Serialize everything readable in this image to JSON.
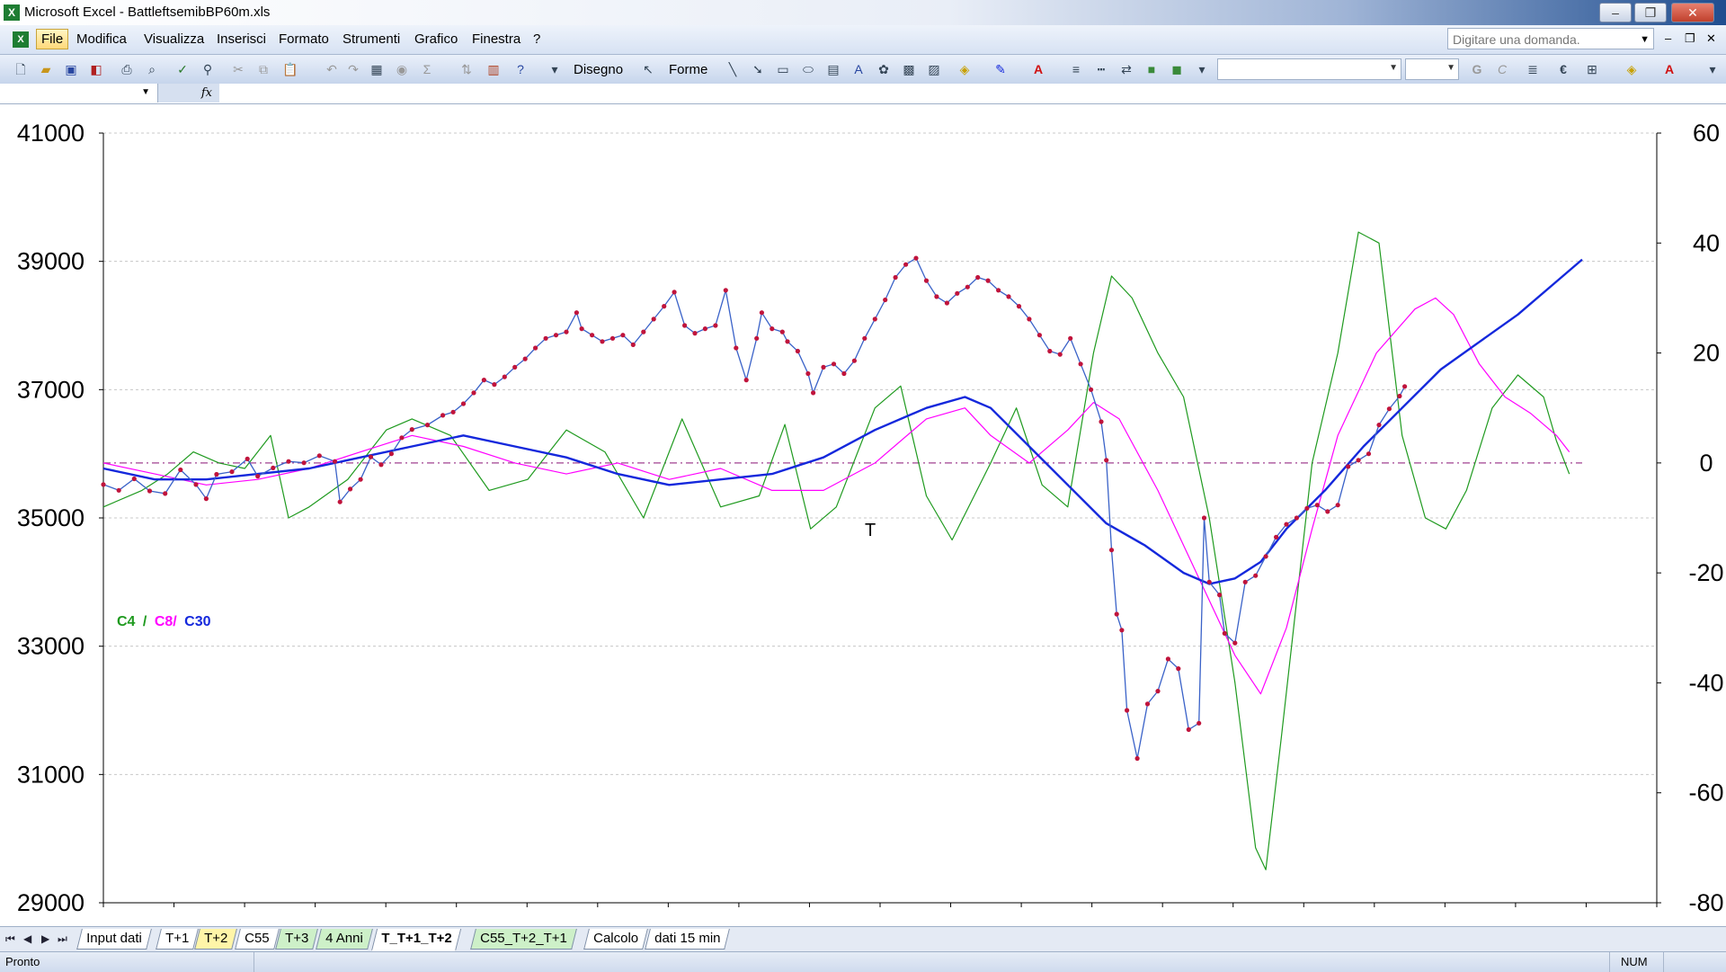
{
  "window": {
    "title": "Microsoft Excel - BattleftsemibBP60m.xls",
    "minimize": "–",
    "maximize": "❐",
    "close": "✕"
  },
  "menu": {
    "items": [
      "File",
      "Modifica",
      "Visualizza",
      "Inserisci",
      "Formato",
      "Strumenti",
      "Grafico",
      "Finestra",
      "?"
    ],
    "help_placeholder": "Digitare una domanda.",
    "doc_controls": [
      "–",
      "❐",
      "✕"
    ]
  },
  "toolbar": {
    "draw_label": "Disegno",
    "shapes_label": "Forme",
    "bold": "G",
    "italic": "C",
    "euro": "€"
  },
  "formula": {
    "fx": "fx"
  },
  "chart_data": {
    "type": "line",
    "legend": [
      {
        "label": "C4",
        "color": "#1f9a1f"
      },
      {
        "label": "/",
        "color": "#1f9a1f"
      },
      {
        "label": "C8/",
        "color": "#ff00ff"
      },
      {
        "label": "C30",
        "color": "#1428dc"
      }
    ],
    "y_left": {
      "min": 29000,
      "max": 41000,
      "ticks": [
        "41000",
        "39000",
        "37000",
        "35000",
        "33000",
        "31000",
        "29000"
      ]
    },
    "y_right": {
      "min": -80,
      "max": 60,
      "ticks": [
        "60",
        "40",
        "20",
        "0",
        "-20",
        "-40",
        "-60",
        "-80"
      ]
    },
    "annotation": "T",
    "colors": {
      "price": "#3a62c8",
      "marker": "#c0143c",
      "c4": "#1f9a1f",
      "c8": "#ff00ff",
      "c30": "#1428dc",
      "zero_line": "#a04090"
    },
    "price": {
      "x_range": [
        0,
        350
      ],
      "points": [
        [
          0,
          35520
        ],
        [
          6,
          35430
        ],
        [
          12,
          35610
        ],
        [
          18,
          35420
        ],
        [
          24,
          35380
        ],
        [
          30,
          35750
        ],
        [
          36,
          35520
        ],
        [
          40,
          35300
        ],
        [
          44,
          35680
        ],
        [
          50,
          35720
        ],
        [
          56,
          35920
        ],
        [
          60,
          35650
        ],
        [
          66,
          35780
        ],
        [
          72,
          35880
        ],
        [
          78,
          35860
        ],
        [
          84,
          35970
        ],
        [
          90,
          35880
        ],
        [
          92,
          35250
        ],
        [
          96,
          35450
        ],
        [
          100,
          35600
        ],
        [
          104,
          35950
        ],
        [
          108,
          35830
        ],
        [
          112,
          36000
        ],
        [
          116,
          36250
        ],
        [
          120,
          36380
        ],
        [
          126,
          36450
        ],
        [
          132,
          36600
        ],
        [
          136,
          36650
        ],
        [
          140,
          36780
        ],
        [
          144,
          36950
        ],
        [
          148,
          37150
        ],
        [
          152,
          37080
        ],
        [
          156,
          37200
        ],
        [
          160,
          37350
        ],
        [
          164,
          37480
        ],
        [
          168,
          37650
        ],
        [
          172,
          37800
        ],
        [
          176,
          37850
        ],
        [
          180,
          37900
        ],
        [
          184,
          38200
        ],
        [
          186,
          37950
        ],
        [
          190,
          37850
        ],
        [
          194,
          37750
        ],
        [
          198,
          37800
        ],
        [
          202,
          37850
        ],
        [
          206,
          37700
        ],
        [
          210,
          37900
        ],
        [
          214,
          38100
        ],
        [
          218,
          38300
        ],
        [
          222,
          38520
        ],
        [
          226,
          38000
        ],
        [
          230,
          37880
        ],
        [
          234,
          37950
        ],
        [
          238,
          38000
        ],
        [
          242,
          38550
        ],
        [
          246,
          37650
        ],
        [
          250,
          37150
        ],
        [
          254,
          37800
        ],
        [
          256,
          38200
        ],
        [
          260,
          37950
        ],
        [
          264,
          37900
        ],
        [
          266,
          37750
        ],
        [
          270,
          37600
        ],
        [
          274,
          37250
        ],
        [
          276,
          36950
        ],
        [
          280,
          37350
        ],
        [
          284,
          37400
        ],
        [
          288,
          37250
        ],
        [
          292,
          37450
        ],
        [
          296,
          37800
        ],
        [
          300,
          38100
        ],
        [
          304,
          38400
        ],
        [
          308,
          38750
        ],
        [
          312,
          38950
        ],
        [
          316,
          39050
        ],
        [
          320,
          38700
        ],
        [
          324,
          38450
        ],
        [
          328,
          38350
        ],
        [
          332,
          38500
        ],
        [
          336,
          38600
        ],
        [
          340,
          38750
        ],
        [
          344,
          38700
        ],
        [
          348,
          38550
        ],
        [
          352,
          38450
        ],
        [
          356,
          38300
        ],
        [
          360,
          38100
        ],
        [
          364,
          37850
        ],
        [
          368,
          37600
        ],
        [
          372,
          37550
        ],
        [
          376,
          37800
        ],
        [
          380,
          37400
        ],
        [
          384,
          37000
        ],
        [
          388,
          36500
        ],
        [
          390,
          35900
        ],
        [
          392,
          34500
        ],
        [
          394,
          33500
        ],
        [
          396,
          33250
        ],
        [
          398,
          32000
        ],
        [
          402,
          31250
        ],
        [
          406,
          32100
        ],
        [
          410,
          32300
        ],
        [
          414,
          32800
        ],
        [
          418,
          32650
        ],
        [
          422,
          31700
        ],
        [
          426,
          31800
        ],
        [
          428,
          35000
        ],
        [
          430,
          34000
        ],
        [
          434,
          33800
        ],
        [
          436,
          33200
        ],
        [
          440,
          33050
        ],
        [
          444,
          34000
        ],
        [
          448,
          34100
        ],
        [
          452,
          34400
        ],
        [
          456,
          34700
        ],
        [
          460,
          34900
        ],
        [
          464,
          35000
        ],
        [
          468,
          35150
        ],
        [
          472,
          35200
        ],
        [
          476,
          35100
        ],
        [
          480,
          35200
        ],
        [
          484,
          35800
        ],
        [
          488,
          35900
        ],
        [
          492,
          36000
        ],
        [
          496,
          36450
        ],
        [
          500,
          36700
        ],
        [
          504,
          36900
        ],
        [
          506,
          37050
        ]
      ]
    },
    "c4": [
      [
        0,
        -8
      ],
      [
        15,
        -5
      ],
      [
        25,
        -2
      ],
      [
        35,
        2
      ],
      [
        45,
        0
      ],
      [
        55,
        -1
      ],
      [
        65,
        5
      ],
      [
        72,
        -10
      ],
      [
        80,
        -8
      ],
      [
        95,
        -3
      ],
      [
        110,
        6
      ],
      [
        120,
        8
      ],
      [
        135,
        5
      ],
      [
        150,
        -5
      ],
      [
        165,
        -3
      ],
      [
        180,
        6
      ],
      [
        195,
        2
      ],
      [
        210,
        -10
      ],
      [
        225,
        8
      ],
      [
        240,
        -8
      ],
      [
        255,
        -6
      ],
      [
        265,
        7
      ],
      [
        275,
        -12
      ],
      [
        285,
        -8
      ],
      [
        300,
        10
      ],
      [
        310,
        14
      ],
      [
        320,
        -6
      ],
      [
        330,
        -14
      ],
      [
        345,
        0
      ],
      [
        355,
        10
      ],
      [
        365,
        -4
      ],
      [
        375,
        -8
      ],
      [
        385,
        20
      ],
      [
        392,
        34
      ],
      [
        400,
        30
      ],
      [
        410,
        20
      ],
      [
        420,
        12
      ],
      [
        430,
        -10
      ],
      [
        440,
        -40
      ],
      [
        448,
        -70
      ],
      [
        452,
        -74
      ],
      [
        458,
        -50
      ],
      [
        470,
        0
      ],
      [
        480,
        20
      ],
      [
        488,
        42
      ],
      [
        496,
        40
      ],
      [
        505,
        5
      ],
      [
        514,
        -10
      ],
      [
        522,
        -12
      ],
      [
        530,
        -5
      ],
      [
        540,
        10
      ],
      [
        550,
        16
      ],
      [
        560,
        12
      ],
      [
        565,
        4
      ],
      [
        570,
        -2
      ]
    ],
    "c8": [
      [
        0,
        0
      ],
      [
        20,
        -2
      ],
      [
        40,
        -4
      ],
      [
        60,
        -3
      ],
      [
        80,
        -1
      ],
      [
        100,
        2
      ],
      [
        120,
        5
      ],
      [
        140,
        3
      ],
      [
        160,
        0
      ],
      [
        180,
        -2
      ],
      [
        200,
        0
      ],
      [
        220,
        -3
      ],
      [
        240,
        -1
      ],
      [
        260,
        -5
      ],
      [
        280,
        -5
      ],
      [
        300,
        0
      ],
      [
        320,
        8
      ],
      [
        335,
        10
      ],
      [
        345,
        5
      ],
      [
        360,
        0
      ],
      [
        375,
        6
      ],
      [
        385,
        11
      ],
      [
        395,
        8
      ],
      [
        410,
        -5
      ],
      [
        425,
        -20
      ],
      [
        440,
        -35
      ],
      [
        450,
        -42
      ],
      [
        460,
        -30
      ],
      [
        470,
        -12
      ],
      [
        480,
        5
      ],
      [
        495,
        20
      ],
      [
        510,
        28
      ],
      [
        518,
        30
      ],
      [
        525,
        27
      ],
      [
        535,
        18
      ],
      [
        545,
        12
      ],
      [
        555,
        9
      ],
      [
        565,
        5
      ],
      [
        570,
        2
      ]
    ],
    "c30": [
      [
        0,
        -1
      ],
      [
        20,
        -3
      ],
      [
        40,
        -3
      ],
      [
        60,
        -2
      ],
      [
        80,
        -1
      ],
      [
        100,
        1
      ],
      [
        120,
        3
      ],
      [
        140,
        5
      ],
      [
        160,
        3
      ],
      [
        180,
        1
      ],
      [
        200,
        -2
      ],
      [
        220,
        -4
      ],
      [
        240,
        -3
      ],
      [
        260,
        -2
      ],
      [
        280,
        1
      ],
      [
        300,
        6
      ],
      [
        320,
        10
      ],
      [
        335,
        12
      ],
      [
        345,
        10
      ],
      [
        360,
        3
      ],
      [
        375,
        -4
      ],
      [
        390,
        -11
      ],
      [
        405,
        -15
      ],
      [
        420,
        -20
      ],
      [
        430,
        -22
      ],
      [
        440,
        -21
      ],
      [
        450,
        -18
      ],
      [
        460,
        -12
      ],
      [
        475,
        -5
      ],
      [
        490,
        3
      ],
      [
        505,
        10
      ],
      [
        520,
        17
      ],
      [
        535,
        22
      ],
      [
        550,
        27
      ],
      [
        565,
        33
      ],
      [
        575,
        37
      ]
    ]
  },
  "sheet_tabs": [
    {
      "label": "Input dati",
      "style": "white"
    },
    {
      "label": "T+1",
      "style": "white"
    },
    {
      "label": "T+2",
      "style": "yellow"
    },
    {
      "label": "C55",
      "style": "white"
    },
    {
      "label": "T+3",
      "style": "green"
    },
    {
      "label": "4 Anni",
      "style": "green"
    },
    {
      "label": "T_T+1_T+2",
      "style": "active"
    },
    {
      "label": "C55_T+2_T+1",
      "style": "green"
    },
    {
      "label": "Calcolo",
      "style": "white"
    },
    {
      "label": "dati 15 min",
      "style": "white"
    }
  ],
  "status": {
    "ready": "Pronto",
    "num": "NUM"
  }
}
